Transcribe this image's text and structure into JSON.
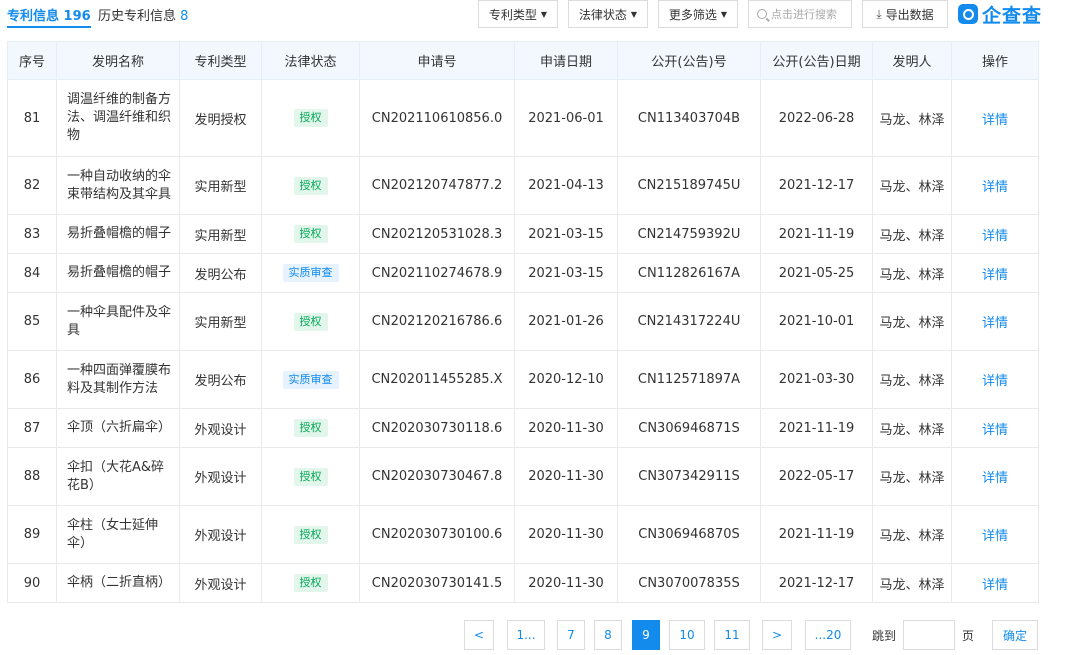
{
  "tabs": [
    {
      "label": "专利信息",
      "count": "196"
    },
    {
      "label": "历史专利信息",
      "count": "8"
    }
  ],
  "toolbar": {
    "filters": [
      "专利类型",
      "法律状态",
      "更多筛选"
    ],
    "search_placeholder": "点击进行搜索",
    "export_label": "导出数据",
    "brand": "企查查"
  },
  "table": {
    "headers": [
      "序号",
      "发明名称",
      "专利类型",
      "法律状态",
      "申请号",
      "申请日期",
      "公开(公告)号",
      "公开(公告)日期",
      "发明人",
      "操作"
    ],
    "rows": [
      {
        "no": "81",
        "name": "调温纤维的制备方法、调温纤维和织物",
        "type": "发明授权",
        "status": "授权",
        "status_kind": "granted",
        "app_no": "CN202110610856.0",
        "app_date": "2021-06-01",
        "pub_no": "CN113403704B",
        "pub_date": "2022-06-28",
        "inventors": "马龙、林泽",
        "action": "详情"
      },
      {
        "no": "82",
        "name": "一种自动收纳的伞束带结构及其伞具",
        "type": "实用新型",
        "status": "授权",
        "status_kind": "granted",
        "app_no": "CN202120747877.2",
        "app_date": "2021-04-13",
        "pub_no": "CN215189745U",
        "pub_date": "2021-12-17",
        "inventors": "马龙、林泽",
        "action": "详情"
      },
      {
        "no": "83",
        "name": "易折叠帽檐的帽子",
        "type": "实用新型",
        "status": "授权",
        "status_kind": "granted",
        "app_no": "CN202120531028.3",
        "app_date": "2021-03-15",
        "pub_no": "CN214759392U",
        "pub_date": "2021-11-19",
        "inventors": "马龙、林泽",
        "action": "详情"
      },
      {
        "no": "84",
        "name": "易折叠帽檐的帽子",
        "type": "发明公布",
        "status": "实质审查",
        "status_kind": "review",
        "app_no": "CN202110274678.9",
        "app_date": "2021-03-15",
        "pub_no": "CN112826167A",
        "pub_date": "2021-05-25",
        "inventors": "马龙、林泽",
        "action": "详情"
      },
      {
        "no": "85",
        "name": "一种伞具配件及伞具",
        "type": "实用新型",
        "status": "授权",
        "status_kind": "granted",
        "app_no": "CN202120216786.6",
        "app_date": "2021-01-26",
        "pub_no": "CN214317224U",
        "pub_date": "2021-10-01",
        "inventors": "马龙、林泽",
        "action": "详情"
      },
      {
        "no": "86",
        "name": "一种四面弹覆膜布料及其制作方法",
        "type": "发明公布",
        "status": "实质审查",
        "status_kind": "review",
        "app_no": "CN202011455285.X",
        "app_date": "2020-12-10",
        "pub_no": "CN112571897A",
        "pub_date": "2021-03-30",
        "inventors": "马龙、林泽",
        "action": "详情"
      },
      {
        "no": "87",
        "name": "伞顶（六折扁伞）",
        "type": "外观设计",
        "status": "授权",
        "status_kind": "granted",
        "app_no": "CN202030730118.6",
        "app_date": "2020-11-30",
        "pub_no": "CN306946871S",
        "pub_date": "2021-11-19",
        "inventors": "马龙、林泽",
        "action": "详情"
      },
      {
        "no": "88",
        "name": "伞扣（大花A&碎花B）",
        "type": "外观设计",
        "status": "授权",
        "status_kind": "granted",
        "app_no": "CN202030730467.8",
        "app_date": "2020-11-30",
        "pub_no": "CN307342911S",
        "pub_date": "2022-05-17",
        "inventors": "马龙、林泽",
        "action": "详情"
      },
      {
        "no": "89",
        "name": "伞柱（女士延伸伞）",
        "type": "外观设计",
        "status": "授权",
        "status_kind": "granted",
        "app_no": "CN202030730100.6",
        "app_date": "2020-11-30",
        "pub_no": "CN306946870S",
        "pub_date": "2021-11-19",
        "inventors": "马龙、林泽",
        "action": "详情"
      },
      {
        "no": "90",
        "name": "伞柄（二折直柄）",
        "type": "外观设计",
        "status": "授权",
        "status_kind": "granted",
        "app_no": "CN202030730141.5",
        "app_date": "2020-11-30",
        "pub_no": "CN307007835S",
        "pub_date": "2021-12-17",
        "inventors": "马龙、林泽",
        "action": "详情"
      }
    ]
  },
  "pagination": {
    "prev": "<",
    "first": "1...",
    "pages": [
      "7",
      "8",
      "9",
      "10",
      "11"
    ],
    "current": "9",
    "next": ">",
    "last": "...20",
    "jump_label": "跳到",
    "page_unit": "页",
    "confirm": "确定"
  },
  "colors": {
    "accent": "#128bed",
    "granted": "#00a854",
    "header_bg": "#f2f8fe"
  }
}
